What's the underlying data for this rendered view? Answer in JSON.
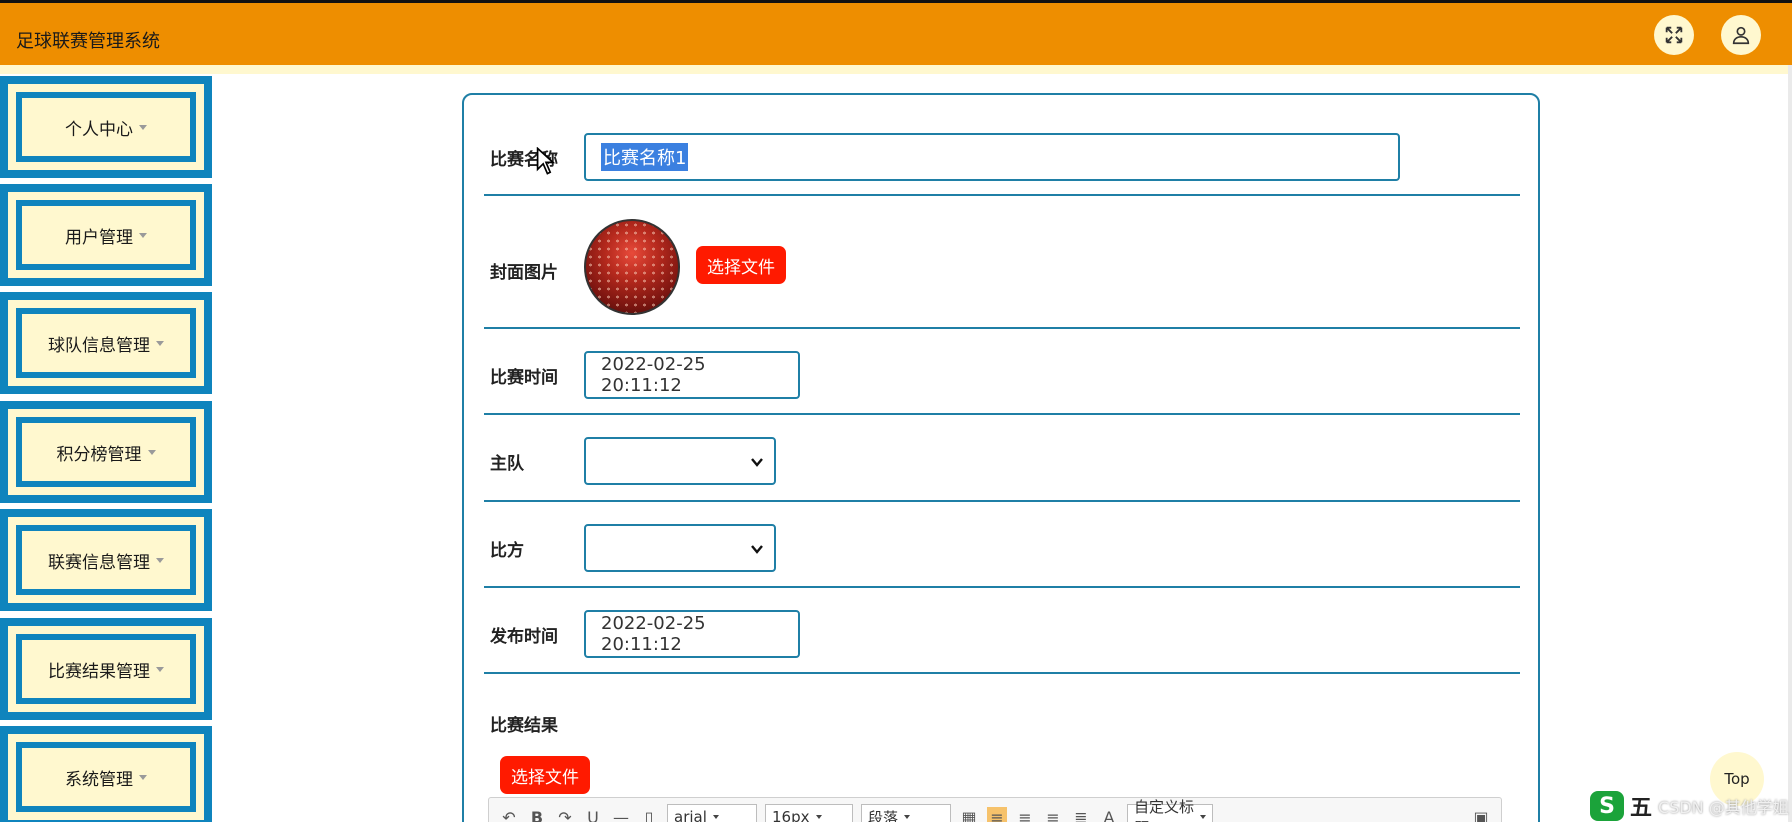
{
  "app": {
    "title": "足球联赛管理系统"
  },
  "header": {
    "fullscreen_icon": "fullscreen-icon",
    "user_icon": "user-icon"
  },
  "sidebar": {
    "items": [
      {
        "label": "个人中心"
      },
      {
        "label": "用户管理"
      },
      {
        "label": "球队信息管理"
      },
      {
        "label": "积分榜管理"
      },
      {
        "label": "联赛信息管理"
      },
      {
        "label": "比赛结果管理"
      },
      {
        "label": "系统管理"
      }
    ]
  },
  "form": {
    "name_label": "比赛名称",
    "name_value": "比赛名称1",
    "cover_label": "封面图片",
    "cover_button": "选择文件",
    "match_time_label": "比赛时间",
    "match_time_value": "2022-02-25 20:11:12",
    "home_label": "主队",
    "home_value": "",
    "score_label": "比方",
    "score_value": "",
    "publish_time_label": "发布时间",
    "publish_time_value": "2022-02-25 20:11:12",
    "result_label": "比赛结果",
    "result_button": "选择文件"
  },
  "editor_toolbar": {
    "font_family": "arial",
    "font_size": "16px",
    "paragraph": "段落",
    "custom_title": "自定义标题"
  },
  "overlay": {
    "top_label": "Top",
    "watermark": "CSDN @其他学姐",
    "ime_logo": "S",
    "ime_mode": "五"
  },
  "colors": {
    "header": "#ee8e00",
    "accent": "#0f84bd",
    "sidebar_bg": "#fff8cf",
    "button": "#ff1a00",
    "border": "#1f7fa6"
  }
}
